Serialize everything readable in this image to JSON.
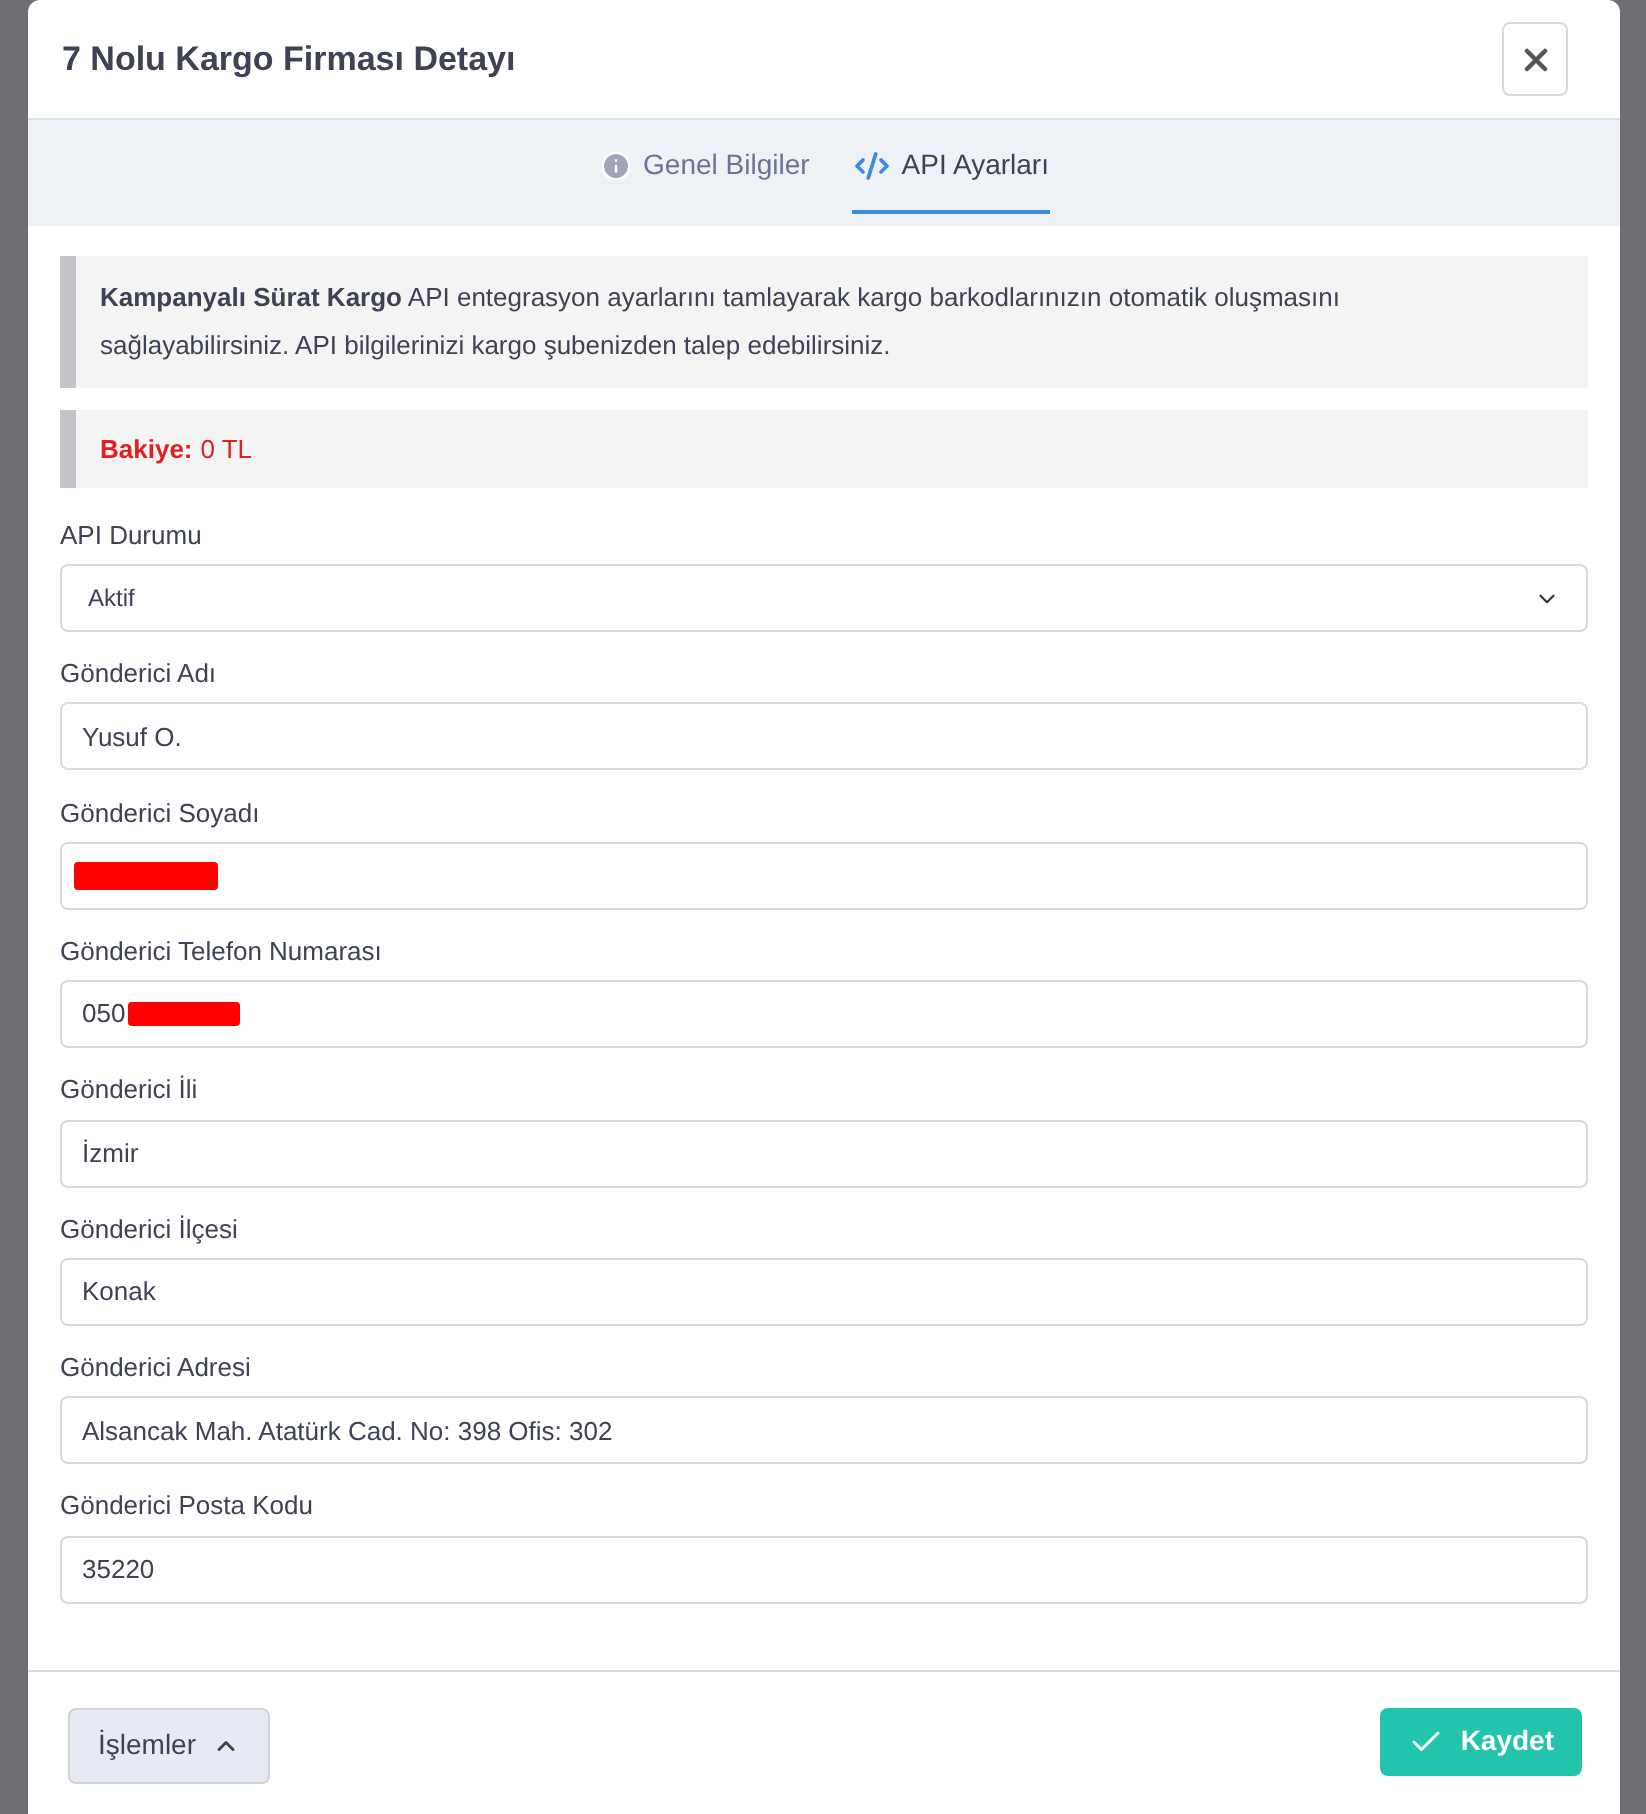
{
  "dialog": {
    "title": "7 Nolu Kargo Firması Detayı"
  },
  "tabs": [
    {
      "label": "Genel Bilgiler",
      "kind": "info",
      "selected": false
    },
    {
      "label": "API Ayarları",
      "kind": "code",
      "selected": true
    }
  ],
  "notice": {
    "text": "**Kampanyalı Sürat Kargo** API entegrasyon ayarlarını tamlayarak kargo barkodlarınızın otomatik oluşmasını sağlayabilirsiniz. API bilgilerinizi kargo şubenizden talep edebilirsiniz."
  },
  "balance": {
    "label": "Bakiye:",
    "value": "0 TL"
  },
  "fields": [
    {
      "label": "API Durumu",
      "kind": "select",
      "value": "Aktif"
    },
    {
      "label": "Gönderici Adı",
      "kind": "text",
      "value": "Yusuf O."
    },
    {
      "label": "Gönderici Soyadı",
      "kind": "text",
      "redacted": true
    },
    {
      "label": "Gönderici Telefon Numarası",
      "kind": "text",
      "value": "050",
      "redacted": true
    },
    {
      "label": "Gönderici İli",
      "kind": "text",
      "value": "İzmir"
    },
    {
      "label": "Gönderici İlçesi",
      "kind": "text",
      "value": "Konak"
    },
    {
      "label": "Gönderici Adresi",
      "kind": "text",
      "value": "Alsancak Mah. Atatürk Cad. No: 398 Ofis: 302"
    },
    {
      "label": "Gönderici Posta Kodu",
      "kind": "text",
      "value": "35220"
    }
  ],
  "footer": {
    "actions_button": "İşlemler",
    "save_button": "Kaydet"
  }
}
